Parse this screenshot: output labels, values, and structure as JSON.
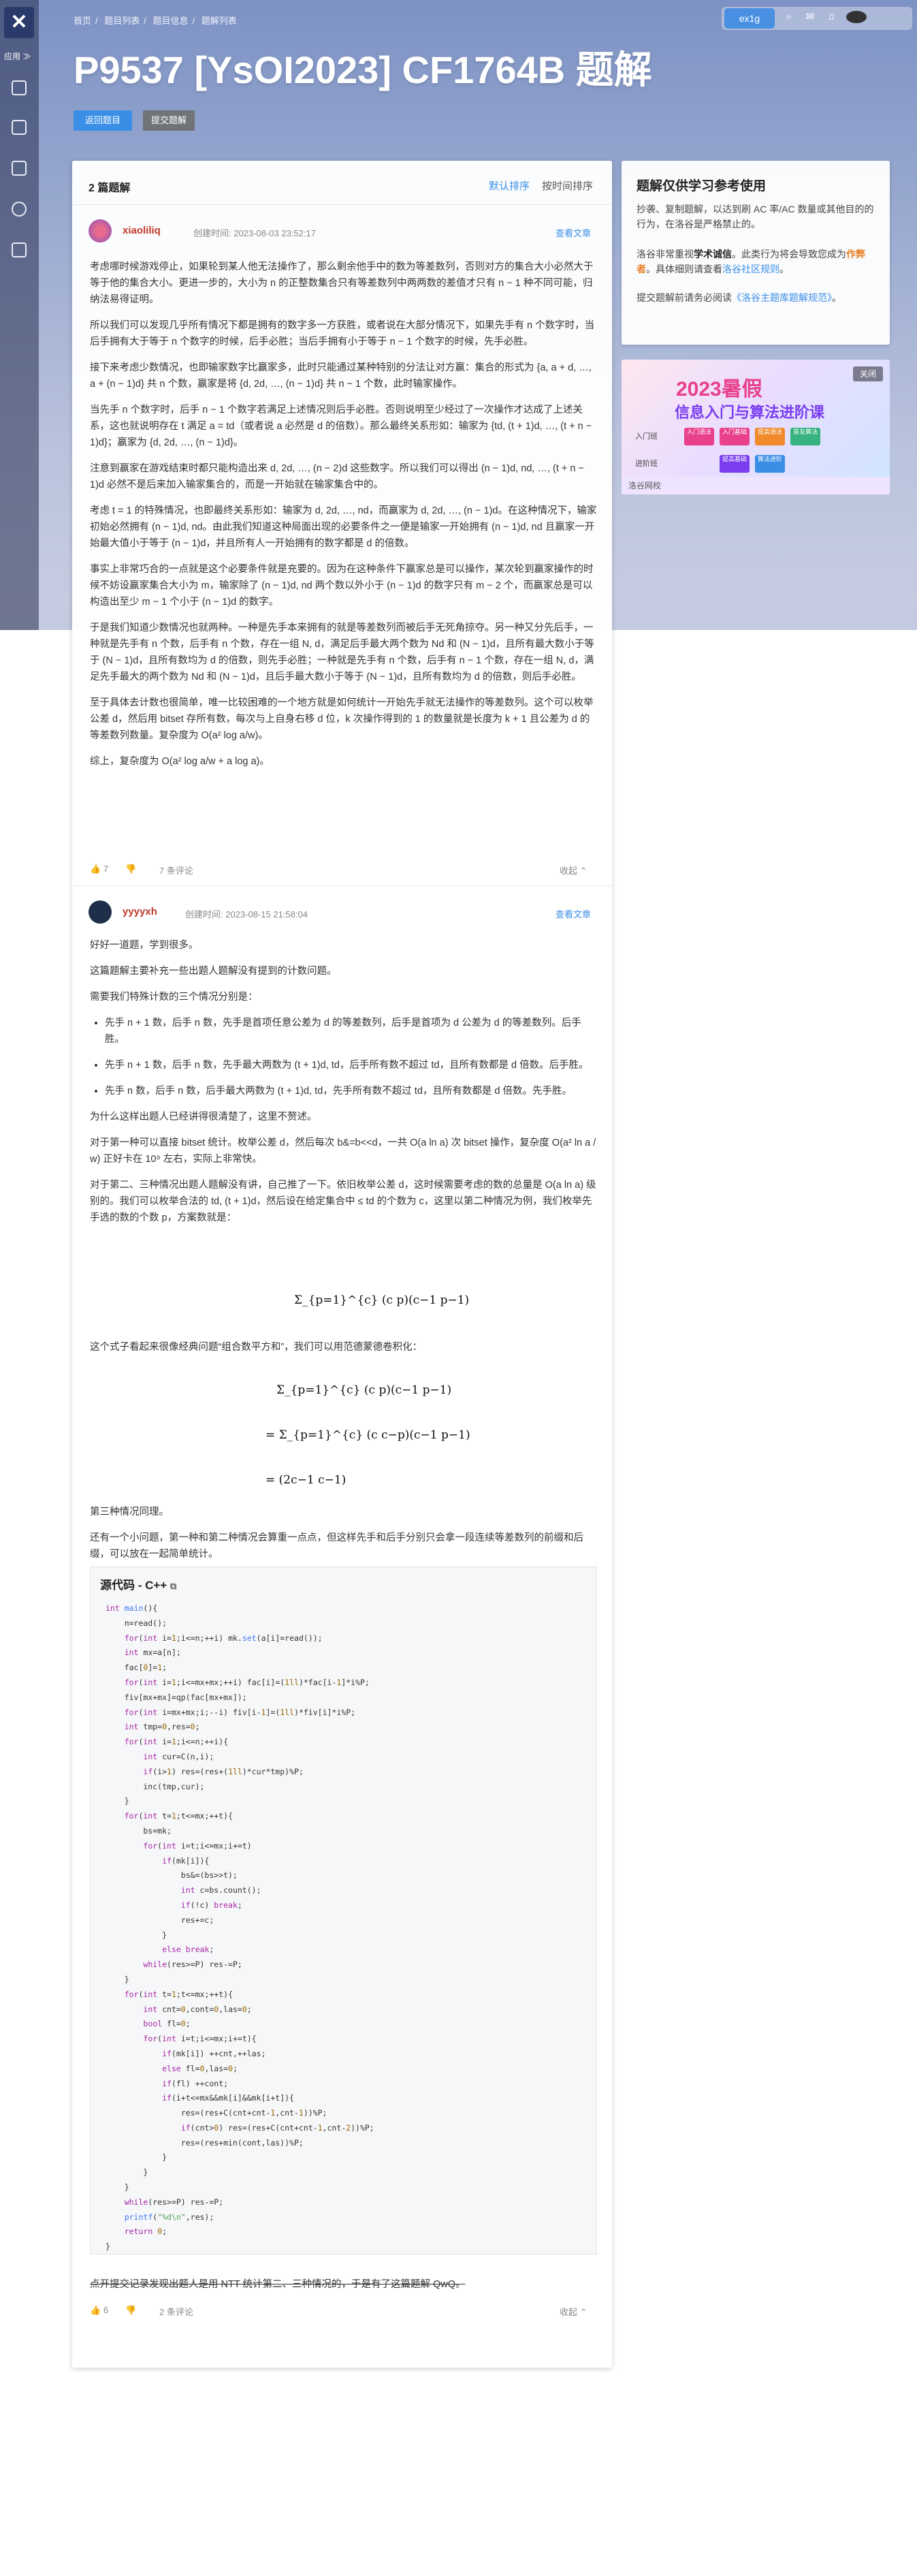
{
  "topbar": {
    "breadcrumb": [
      "首页",
      "题目列表",
      "题目信息",
      "题解列表"
    ],
    "lang": "ex1g",
    "icons": [
      "search-icon",
      "mail-icon",
      "bell-icon",
      "avatar"
    ]
  },
  "leftbar": {
    "menu_label": "应用 ≫"
  },
  "page": {
    "title": "P9537 [YsOI2023] CF1764B 题解"
  },
  "buttons": {
    "back": "返回题目",
    "submit": "提交题解"
  },
  "list": {
    "count_label": "2 篇题解",
    "sort_default": "默认排序",
    "sort_time": "按时间排序"
  },
  "side": {
    "title": "题解仅供学习参考使用",
    "p1": "抄袭、复制题解，以达到刷 AC 率/AC 数量或其他目的的行为，在洛谷是严格禁止的。",
    "p2a": "洛谷非常重视",
    "p2b": "学术诚信",
    "p2c": "。此类行为将会导致您成为",
    "p2d": "作弊者",
    "p2e": "。具体细则请查看",
    "p2f": "洛谷社区规则",
    "p2g": "。",
    "p3a": "提交题解前请务必阅读",
    "p3b": "《洛谷主题库题解规范》",
    "p3c": "。"
  },
  "ad": {
    "title": "2023暑假",
    "subtitle": "信息入门与算法进阶课",
    "close": "关闭",
    "rows": [
      "入门班",
      "进阶班"
    ],
    "chips": [
      "入门语法",
      "入门基础",
      "提高语法",
      "普及算法",
      "提高基础",
      "算法进阶"
    ],
    "bar": "洛谷网校"
  },
  "solution1": {
    "author": "xiaoliliq",
    "time": "创建时间: 2023-08-03 23:52:17",
    "view": "查看文章",
    "paragraphs": [
      "考虑哪时候游戏停止，如果轮到某人他无法操作了，那么剩余他手中的数为等差数列，否则对方的集合大小必然大于等于他的集合大小。更进一步的，大小为 n 的正整数集合只有等差数列中两两数的差值才只有 n − 1 种不同可能，归纳法易得证明。",
      "所以我们可以发现几乎所有情况下都是拥有的数字多一方获胜，或者说在大部分情况下，如果先手有 n 个数字时，当后手拥有大于等于 n 个数字的时候，后手必胜；当后手拥有小于等于 n − 1 个数字的时候，先手必胜。",
      "接下来考虑少数情况，也即输家数字比赢家多，此时只能通过某种特别的分法让对方赢：集合的形式为 {a, a + d, …, a + (n − 1)d} 共 n 个数，赢家是将 {d, 2d, …, (n − 1)d} 共 n − 1 个数，此时输家操作。",
      "当先手 n 个数字时，后手 n − 1 个数字若满足上述情况则后手必胜。否则说明至少经过了一次操作才达成了上述关系，这也就说明存在 t 满足 a = td（或者说 a 必然是 d 的倍数）。那么最终关系形如：输家为 {td, (t + 1)d, …, (t + n − 1)d}；赢家为 {d, 2d, …, (n − 1)d}。",
      "注意到赢家在游戏结束时都只能构造出来 d, 2d, …, (n − 2)d 这些数字。所以我们可以得出 (n − 1)d, nd, …, (t + n − 1)d 必然不是后来加入输家集合的，而是一开始就在输家集合中的。",
      "考虑 t = 1 的特殊情况，也即最终关系形如：输家为 d, 2d, …, nd，而赢家为 d, 2d, …, (n − 1)d。在这种情况下，输家初始必然拥有 (n − 1)d, nd。由此我们知道这种局面出现的必要条件之一便是输家一开始拥有 (n − 1)d, nd 且赢家一开始最大值小于等于 (n − 1)d，并且所有人一开始拥有的数字都是 d 的倍数。",
      "事实上非常巧合的一点就是这个必要条件就是充要的。因为在这种条件下赢家总是可以操作，某次轮到赢家操作的时候不妨设赢家集合大小为 m，输家除了 (n − 1)d, nd 两个数以外小于 (n − 1)d 的数字只有 m − 2 个，而赢家总是可以构造出至少 m − 1 个小于 (n − 1)d 的数字。",
      "于是我们知道少数情况也就两种。一种是先手本来拥有的就是等差数列而被后手无死角掠夺。另一种又分先后手，一种就是先手有 n 个数，后手有 n 个数，存在一组 N, d，满足后手最大两个数为 Nd 和 (N − 1)d，且所有最大数小于等于 (N − 1)d，且所有数均为 d 的倍数，则先手必胜；一种就是先手有 n 个数，后手有 n − 1 个数，存在一组 N, d，满足先手最大的两个数为 Nd 和 (N − 1)d，且后手最大数小于等于 (N − 1)d，且所有数均为 d 的倍数，则后手必胜。",
      "至于具体去计数也很简单，唯一比较困难的一个地方就是如何统计一开始先手就无法操作的等差数列。这个可以枚举公差 d，然后用 bitset 存所有数，每次与上自身右移 d 位，k 次操作得到的 1 的数量就是长度为 k + 1 且公差为 d 的等差数列数量。复杂度为 O(a² log a/w)。",
      "综上，复杂度为 O(a² log a/w + a log a)。"
    ],
    "likes": "7",
    "comments": "7 条评论",
    "collapse": "收起 ⌃"
  },
  "solution2": {
    "author": "yyyyxh",
    "time": "创建时间: 2023-08-15 21:58:04",
    "view": "查看文章",
    "p1": "好好一道题，学到很多。",
    "p2": "这篇题解主要补充一些出题人题解没有提到的计数问题。",
    "p3": "需要我们特殊计数的三个情况分别是：",
    "bullets": [
      "先手 n + 1 数，后手 n 数，先手是首项任意公差为 d 的等差数列，后手是首项为 d 公差为 d 的等差数列。后手胜。",
      "先手 n + 1 数，后手 n 数，先手最大两数为 (t + 1)d, td，后手所有数不超过 td，且所有数都是 d 倍数。后手胜。",
      "先手 n 数，后手 n 数，后手最大两数为 (t + 1)d, td，先手所有数不超过 td，且所有数都是 d 倍数。先手胜。"
    ],
    "p4": "为什么这样出题人已经讲得很清楚了，这里不赘述。",
    "p5": "对于第一种可以直接 bitset 统计。枚举公差 d，然后每次 b&=b<<d，一共 O(a ln a) 次 bitset 操作，复杂度 O(a² ln a / w) 正好卡在 10⁹ 左右，实际上非常快。",
    "p6": "对于第二、三种情况出题人题解没有讲，自己推了一下。依旧枚举公差 d，这时候需要考虑的数的总量是 O(a ln a) 级别的。我们可以枚举合法的 td, (t + 1)d，然后设在给定集合中 ≤ td 的个数为 c，这里以第二种情况为例，我们枚举先手选的数的个数 p，方案数就是：",
    "f1": "Σ_{p=1}^{c} (c p)(c−1 p−1)",
    "p7": "这个式子看起来很像经典问题“组合数平方和”，我们可以用范德蒙德卷积化：",
    "f2a": "Σ_{p=1}^{c} (c p)(c−1 p−1)",
    "f2b": "= Σ_{p=1}^{c} (c c−p)(c−1 p−1)",
    "f2c": "= (2c−1 c−1)",
    "p8": "第三种情况同理。",
    "p9": "还有一个小问题，第一种和第二种情况会算重一点点，但这样先手和后手分别只会拿一段连续等差数列的前缀和后缀，可以放在一起简单统计。",
    "code_title": "源代码 - C++",
    "footer_strike": "点开提交记录发现出题人是用 NTT 统计第二、三种情况的，于是有了这篇题解 QwQ。",
    "likes": "6",
    "comments": "2 条评论",
    "collapse": "收起 ⌃"
  }
}
